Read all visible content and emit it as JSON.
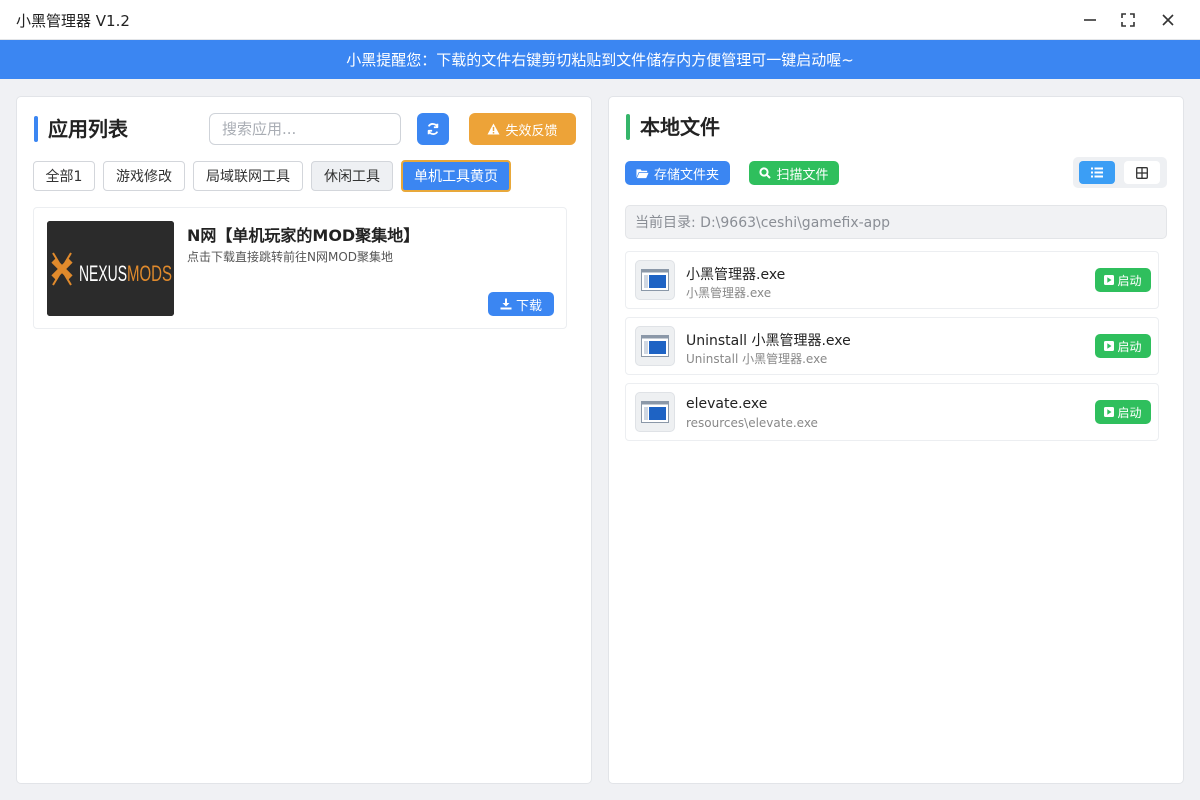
{
  "window": {
    "title": "小黑管理器 V1.2"
  },
  "banner": {
    "text": "小黑提醒您：下载的文件右键剪切粘贴到文件储存内方便管理可一键启动喔~"
  },
  "left_panel": {
    "title": "应用列表",
    "search_placeholder": "搜索应用...",
    "feedback_label": "失效反馈",
    "tabs": [
      {
        "label": "全部1"
      },
      {
        "label": "游戏修改"
      },
      {
        "label": "局域联网工具"
      },
      {
        "label": "休闲工具"
      },
      {
        "label": "单机工具黄页"
      }
    ],
    "active_tab": "单机工具黄页",
    "apps": [
      {
        "name": "N网【单机玩家的MOD聚集地】",
        "description": "点击下载直接跳转前往N网MOD聚集地",
        "download_label": "下载",
        "logo_text_1": "NEXUS",
        "logo_text_2": "MODS"
      }
    ]
  },
  "right_panel": {
    "title": "本地文件",
    "storage_label": "存储文件夹",
    "scan_label": "扫描文件",
    "current_dir": "当前目录: D:\\9663\\ceshi\\gamefix-app",
    "view_mode": "list",
    "files": [
      {
        "name": "小黑管理器.exe",
        "path": "小黑管理器.exe",
        "launch_label": "启动"
      },
      {
        "name": "Uninstall 小黑管理器.exe",
        "path": "Uninstall 小黑管理器.exe",
        "launch_label": "启动"
      },
      {
        "name": "elevate.exe",
        "path": "resources\\elevate.exe",
        "launch_label": "启动"
      }
    ]
  },
  "colors": {
    "accent_blue": "#3b86f2",
    "accent_green": "#2fbf5d",
    "accent_orange": "#eda338"
  }
}
